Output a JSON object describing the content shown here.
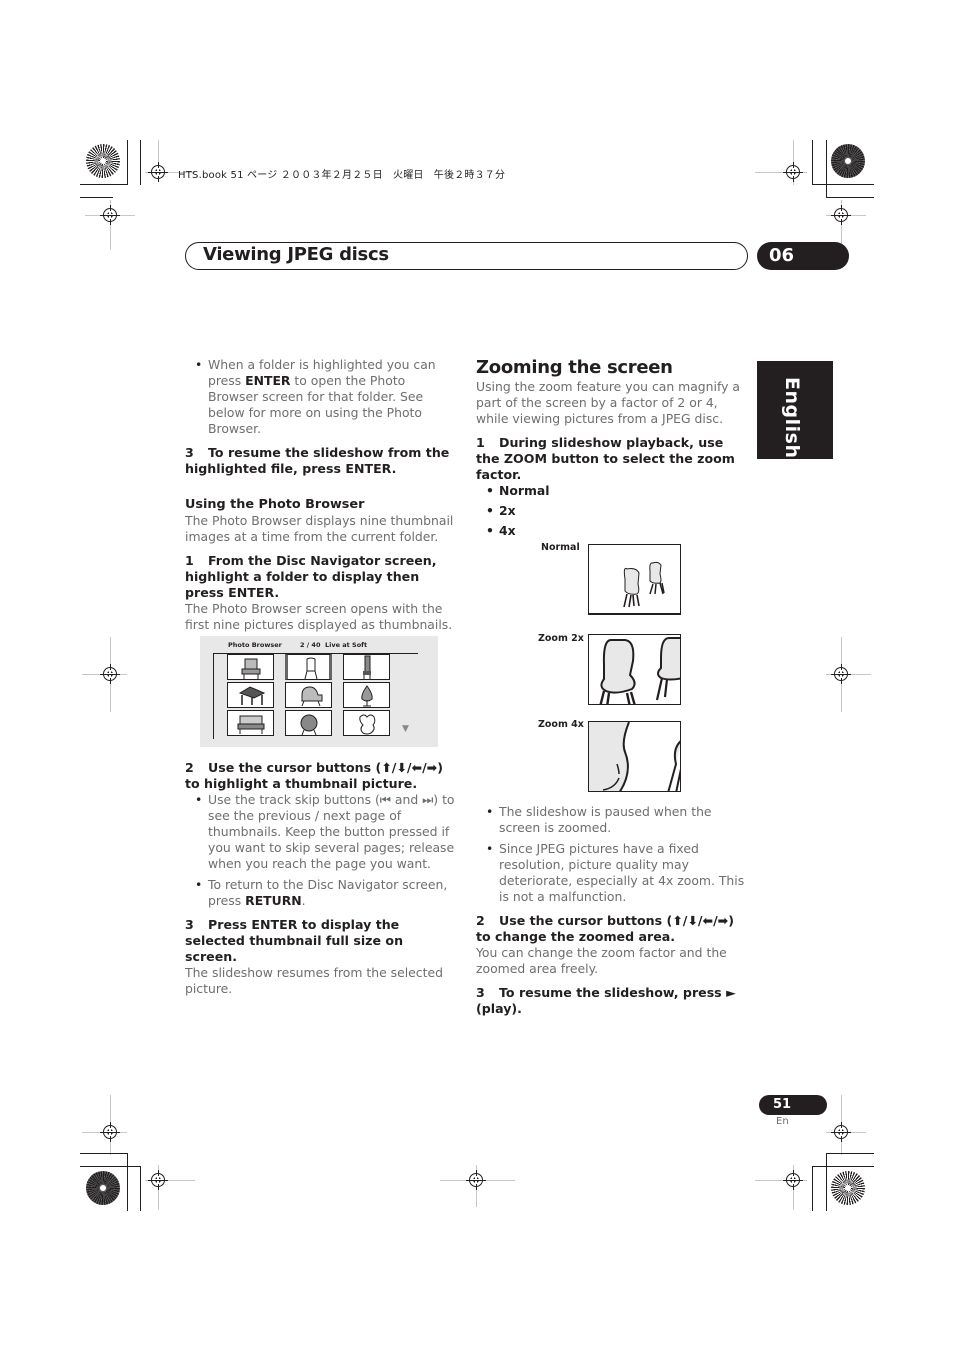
{
  "print_header": "HTS.book  51 ページ  ２００３年２月２５日　火曜日　午後２時３７分",
  "chapter": {
    "title": "Viewing JPEG discs",
    "number": "06"
  },
  "language_tab": "English",
  "left_column": {
    "bullet_intro": {
      "pre": "When a folder is highlighted you can press ",
      "key": "ENTER",
      "post": " to open the Photo Browser screen for that folder. See below for more on using the Photo Browser."
    },
    "step3": {
      "num": "3",
      "text": "To resume the slideshow from the highlighted file, press ENTER."
    },
    "section_heading": "Using the Photo Browser",
    "section_intro": "The Photo Browser displays nine thumbnail images at a time from the current folder.",
    "step1": {
      "num": "1",
      "text": "From the Disc Navigator screen, highlight a folder to display then press ENTER."
    },
    "step1_body": "The Photo Browser screen opens with the first nine pictures displayed as thumbnails.",
    "photo_browser": {
      "title": "Photo Browser",
      "count": "2 / 40",
      "album": "Live at Soft",
      "thumbnails": [
        "armchair",
        "chair-highlighted",
        "tall-chair",
        "table",
        "piano",
        "egg-chair",
        "sofa",
        "round-chair",
        "cloud-chair"
      ],
      "next_page_icon": "down-arrow-icon"
    },
    "step2": {
      "num": "2",
      "text": "Use the cursor buttons (⬆/⬇/⬅/➡) to highlight a thumbnail picture."
    },
    "step2_bullets": [
      {
        "pre": "Use the track skip buttons (⏮ and ⏭) to see the previous / next page of thumbnails. Keep the button pressed if you want to skip several pages; release when you reach the page you want.",
        "key": "",
        "post": ""
      },
      {
        "pre": "To return to the Disc Navigator screen, press ",
        "key": "RETURN",
        "post": "."
      }
    ],
    "step3b": {
      "num": "3",
      "text": "Press ENTER to display the selected thumbnail full size on screen."
    },
    "step3b_body": "The slideshow resumes from the selected picture."
  },
  "right_column": {
    "heading": "Zooming the screen",
    "intro": "Using the zoom feature you can magnify a part of the screen by a factor of 2 or 4, while viewing pictures from a JPEG disc.",
    "step1": {
      "num": "1",
      "text": "During slideshow playback, use the ZOOM button to select the zoom factor."
    },
    "zoom_options": [
      "Normal",
      "2x",
      "4x"
    ],
    "figures": [
      {
        "label": "Normal"
      },
      {
        "label": "Zoom 2x"
      },
      {
        "label": "Zoom 4x"
      }
    ],
    "notes": [
      "The slideshow is paused when the screen is zoomed.",
      "Since JPEG pictures have a fixed resolution, picture quality may deteriorate, especially at 4x zoom. This is not a malfunction."
    ],
    "step2": {
      "num": "2",
      "text": "Use the cursor buttons (⬆/⬇/⬅/➡) to change the zoomed area."
    },
    "step2_body": "You can change the zoom factor and the zoomed area freely.",
    "step3": {
      "num": "3",
      "text": "To resume the slideshow, press ► (play)."
    }
  },
  "footer": {
    "page_number": "51",
    "language": "En"
  }
}
